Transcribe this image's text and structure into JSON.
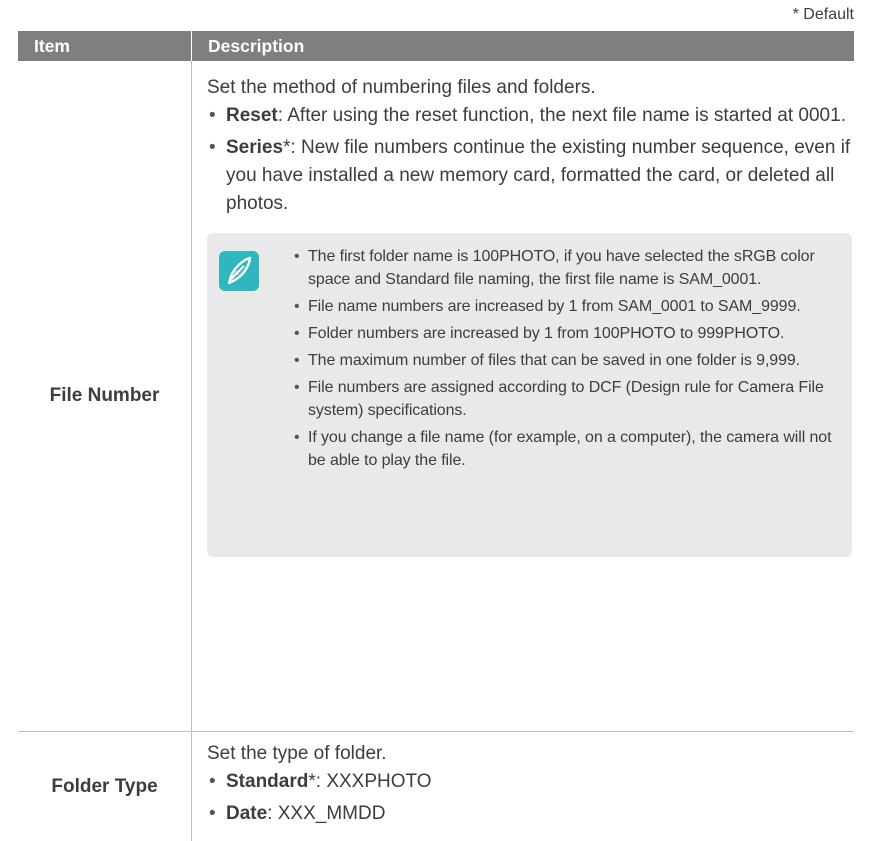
{
  "default_note": "* Default",
  "table": {
    "headers": {
      "item": "Item",
      "description": "Description"
    },
    "rows": [
      {
        "item": "File Number",
        "intro": "Set the method of numbering files and folders.",
        "options": [
          {
            "term": "Reset",
            "default_mark": "",
            "text": ": After using the reset function, the next file name is started at 0001."
          },
          {
            "term": "Series",
            "default_mark": "*",
            "text": ": New file numbers continue the existing number sequence, even if you have installed a new memory card, formatted the card, or deleted all photos."
          }
        ],
        "note": {
          "icon": "note-pen-icon",
          "items": [
            "The first folder name is 100PHOTO, if you have selected the sRGB color space and Standard file naming, the first file name is SAM_0001.",
            "File name numbers are increased by 1 from SAM_0001 to SAM_9999.",
            "Folder numbers are increased by 1 from 100PHOTO to 999PHOTO.",
            "The maximum number of files that can be saved in one folder is 9,999.",
            "File numbers are assigned according to DCF (Design rule for Camera File system) specifications.",
            "If you change a file name (for example, on a computer), the camera will not be able to play the file."
          ]
        }
      },
      {
        "item": "Folder Type",
        "intro": "Set the type of folder.",
        "options": [
          {
            "term": "Standard",
            "default_mark": "*",
            "text": ": XXXPHOTO"
          },
          {
            "term": "Date",
            "default_mark": "",
            "text": ": XXX_MMDD"
          }
        ]
      }
    ]
  },
  "colors": {
    "header_bg": "#7f7f7f",
    "note_bg": "#e9e9e9",
    "note_icon": "#2fb7c0",
    "text": "#3d3d3d"
  }
}
